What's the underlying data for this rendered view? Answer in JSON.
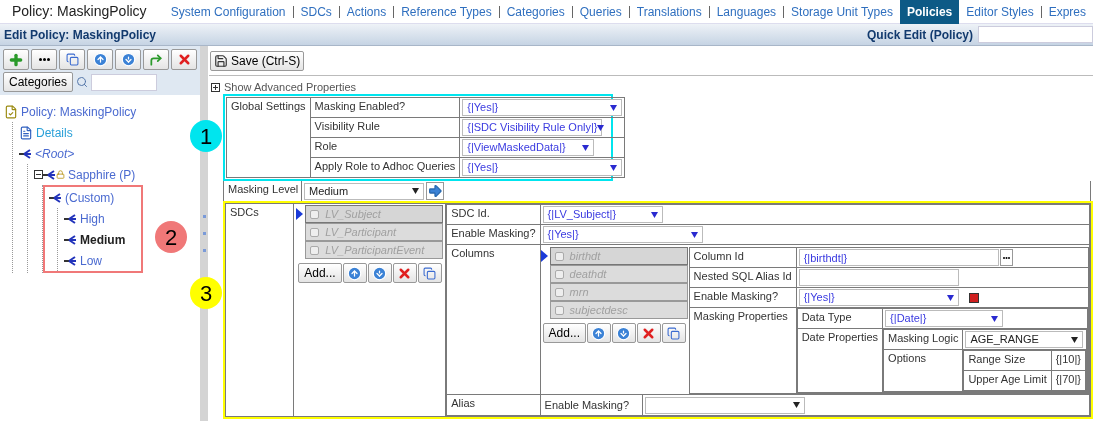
{
  "header": {
    "title": "Policy: MaskingPolicy",
    "nav": [
      {
        "label": "System Configuration",
        "selected": false
      },
      {
        "label": "SDCs",
        "selected": false
      },
      {
        "label": "Actions",
        "selected": false
      },
      {
        "label": "Reference Types",
        "selected": false
      },
      {
        "label": "Categories",
        "selected": false
      },
      {
        "label": "Queries",
        "selected": false
      },
      {
        "label": "Translations",
        "selected": false
      },
      {
        "label": "Languages",
        "selected": false
      },
      {
        "label": "Storage Unit Types",
        "selected": false
      },
      {
        "label": "Policies",
        "selected": true
      },
      {
        "label": "Editor Styles",
        "selected": false
      },
      {
        "label": "Expres",
        "selected": false
      }
    ]
  },
  "subheader": {
    "title": "Edit Policy: MaskingPolicy",
    "quick_edit_label": "Quick Edit (Policy)"
  },
  "left_pane": {
    "categories_button": "Categories",
    "tree": [
      {
        "label": "Policy: MaskingPolicy",
        "kind": "policy",
        "selected": false,
        "children": [
          {
            "label": "Details",
            "kind": "details",
            "selected": false
          },
          {
            "label": "<Root>",
            "kind": "root",
            "selected": false,
            "children": [
              {
                "label": "Sapphire (P)",
                "kind": "locked",
                "selected": false,
                "children": [
                  {
                    "label": "(Custom)",
                    "kind": "node",
                    "selected": false,
                    "annotation": {
                      "label": "2",
                      "color": "#f07878"
                    },
                    "children": [
                      {
                        "label": "High",
                        "kind": "node",
                        "selected": false
                      },
                      {
                        "label": "Medium",
                        "kind": "node",
                        "selected": true
                      },
                      {
                        "label": "Low",
                        "kind": "node",
                        "selected": false
                      }
                    ]
                  }
                ]
              }
            ]
          }
        ]
      }
    ]
  },
  "form": {
    "save_button": "Save (Ctrl-S)",
    "advanced_toggle": "Show Advanced Properties",
    "global_settings": {
      "label": "Global Settings",
      "annotation": {
        "label": "1",
        "color": "#00e5ee"
      },
      "rows": [
        {
          "label": "Masking Enabled?",
          "value": "{|Yes|}"
        },
        {
          "label": "Visibility Rule",
          "value": "{|SDC Visibility Rule Only|}"
        },
        {
          "label": "Role",
          "value": "{|ViewMaskedData|}"
        },
        {
          "label": "Apply Role to Adhoc Queries",
          "value": "{|Yes|}"
        }
      ]
    },
    "masking_level": {
      "label": "Masking Level",
      "value": "Medium"
    },
    "sdcs": {
      "label": "SDCs",
      "annotation": {
        "label": "3",
        "color": "#ffff00"
      },
      "items": [
        {
          "label": "LV_Subject",
          "selected": true,
          "checked": false
        },
        {
          "label": "LV_Participant",
          "selected": false,
          "checked": false
        },
        {
          "label": "LV_ParticipantEvent",
          "selected": false,
          "checked": false
        }
      ],
      "add_button": "Add...",
      "sdc_id": {
        "label": "SDC Id.",
        "value": "{|LV_Subject|}"
      },
      "enable_masking": {
        "label": "Enable Masking?",
        "value": "{|Yes|}"
      },
      "columns": {
        "label": "Columns",
        "items": [
          {
            "label": "birthdt",
            "selected": true,
            "checked": false
          },
          {
            "label": "deathdt",
            "selected": false,
            "checked": false
          },
          {
            "label": "mrn",
            "selected": false,
            "checked": false
          },
          {
            "label": "subjectdesc",
            "selected": false,
            "checked": false
          }
        ],
        "add_button": "Add...",
        "detail": {
          "column_id": {
            "label": "Column Id",
            "value": "{|birthdt|}"
          },
          "nested_sql_alias_id": {
            "label": "Nested SQL Alias Id"
          },
          "enable_masking": {
            "label": "Enable Masking?",
            "value": "{|Yes|}"
          },
          "masking_properties": {
            "label": "Masking Properties",
            "data_type": {
              "label": "Data Type",
              "value": "{|Date|}"
            },
            "date_properties": {
              "label": "Date Properties",
              "masking_logic": {
                "label": "Masking Logic",
                "value": "AGE_RANGE"
              },
              "options": {
                "label": "Options",
                "range_size": {
                  "label": "Range Size",
                  "value": "{|10|}"
                },
                "upper_age_limit": {
                  "label": "Upper Age Limit",
                  "value": "{|70|}"
                }
              }
            }
          }
        }
      },
      "alias": {
        "label": "Alias",
        "enable_masking_label": "Enable Masking?"
      }
    }
  }
}
